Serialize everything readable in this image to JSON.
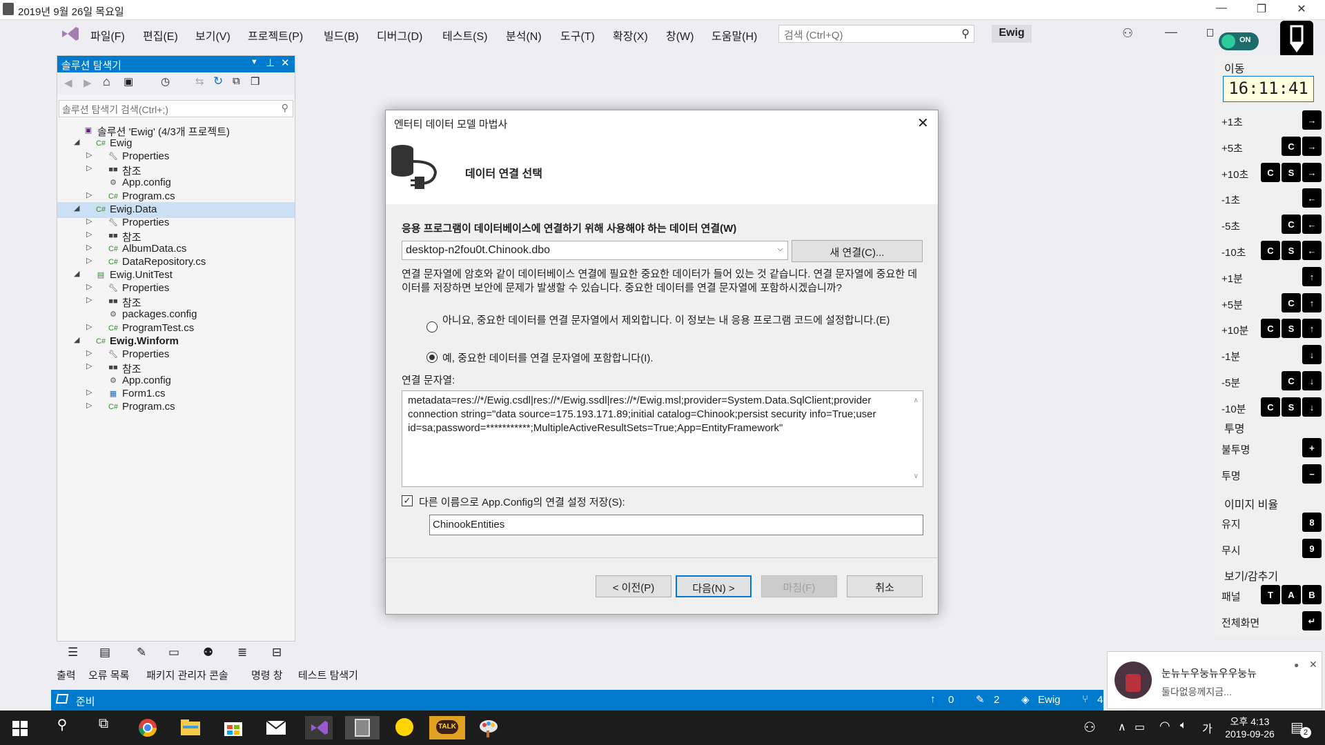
{
  "outer_title": {
    "text": "2019년 9월 26일 목요일"
  },
  "menu": {
    "items": [
      "파일(F)",
      "편집(E)",
      "보기(V)",
      "프로젝트(P)",
      "빌드(B)",
      "디버그(D)",
      "테스트(S)",
      "분석(N)",
      "도구(T)",
      "확장(X)",
      "창(W)",
      "도움말(H)"
    ],
    "search_placeholder": "검색 (Ctrl+Q)",
    "solution_name": "Ewig",
    "toggle_label": "ON"
  },
  "solution_explorer": {
    "title": "솔루션 탐색기",
    "search_placeholder": "솔루션 탐색기 검색(Ctrl+;)",
    "tree": [
      {
        "label": "솔루션 'Ewig' (4/3개 프로젝트)",
        "depth": 0,
        "arrow": "",
        "icon": "solution"
      },
      {
        "label": "Ewig",
        "depth": 1,
        "arrow": "◢",
        "icon": "csproj"
      },
      {
        "label": "Properties",
        "depth": 2,
        "arrow": "▷",
        "icon": "wrench"
      },
      {
        "label": "참조",
        "depth": 2,
        "arrow": "▷",
        "icon": "ref"
      },
      {
        "label": "App.config",
        "depth": 2,
        "arrow": "",
        "icon": "config"
      },
      {
        "label": "Program.cs",
        "depth": 2,
        "arrow": "▷",
        "icon": "cs"
      },
      {
        "label": "Ewig.Data",
        "depth": 1,
        "arrow": "◢",
        "icon": "csproj",
        "selected": true
      },
      {
        "label": "Properties",
        "depth": 2,
        "arrow": "▷",
        "icon": "wrench"
      },
      {
        "label": "참조",
        "depth": 2,
        "arrow": "▷",
        "icon": "ref"
      },
      {
        "label": "AlbumData.cs",
        "depth": 2,
        "arrow": "▷",
        "icon": "cs"
      },
      {
        "label": "DataRepository.cs",
        "depth": 2,
        "arrow": "▷",
        "icon": "cs"
      },
      {
        "label": "Ewig.UnitTest",
        "depth": 1,
        "arrow": "◢",
        "icon": "testproj"
      },
      {
        "label": "Properties",
        "depth": 2,
        "arrow": "▷",
        "icon": "wrench"
      },
      {
        "label": "참조",
        "depth": 2,
        "arrow": "▷",
        "icon": "ref"
      },
      {
        "label": "packages.config",
        "depth": 2,
        "arrow": "",
        "icon": "config"
      },
      {
        "label": "ProgramTest.cs",
        "depth": 2,
        "arrow": "▷",
        "icon": "cs"
      },
      {
        "label": "Ewig.Winform",
        "depth": 1,
        "arrow": "◢",
        "icon": "csproj",
        "bold": true
      },
      {
        "label": "Properties",
        "depth": 2,
        "arrow": "▷",
        "icon": "wrench"
      },
      {
        "label": "참조",
        "depth": 2,
        "arrow": "▷",
        "icon": "ref"
      },
      {
        "label": "App.config",
        "depth": 2,
        "arrow": "",
        "icon": "config"
      },
      {
        "label": "Form1.cs",
        "depth": 2,
        "arrow": "▷",
        "icon": "form"
      },
      {
        "label": "Program.cs",
        "depth": 2,
        "arrow": "▷",
        "icon": "cs"
      }
    ]
  },
  "bottom_tabs": [
    "출력",
    "오류 목록",
    "패키지 관리자 콘솔",
    "명령 창",
    "테스트 탐색기"
  ],
  "statusbar": {
    "left": "준비",
    "up": "0",
    "edit": "2",
    "repo": "Ewig",
    "branch": "4"
  },
  "dialog": {
    "title": "엔터티 데이터 모델 마법사",
    "subtitle": "데이터 연결 선택",
    "question": "응용 프로그램이 데이터베이스에 연결하기 위해 사용해야 하는 데이터 연결(W)",
    "connection": "desktop-n2fou0t.Chinook.dbo",
    "new_conn": "새 연결(C)...",
    "warning": "연결 문자열에 암호와 같이 데이터베이스 연결에 필요한 중요한 데이터가 들어 있는 것 같습니다. 연결 문자열에 중요한 데이터를 저장하면 보안에 문제가 발생할 수 있습니다. 중요한 데이터를 연결 문자열에 포함하시겠습니까?",
    "radio_no": "아니요, 중요한 데이터를 연결 문자열에서 제외합니다. 이 정보는 내 응용 프로그램 코드에 설정합니다.(E)",
    "radio_yes": "예, 중요한 데이터를 연결 문자열에 포함합니다(I).",
    "connstr_label": "연결 문자열:",
    "connstr": "metadata=res://*/Ewig.csdl|res://*/Ewig.ssdl|res://*/Ewig.msl;provider=System.Data.SqlClient;provider connection string=\"data source=175.193.171.89;initial catalog=Chinook;persist security info=True;user id=sa;password=***********;MultipleActiveResultSets=True;App=EntityFramework\"",
    "save_check": "다른 이름으로 App.Config의 연결 설정 저장(S):",
    "config_name": "ChinookEntities",
    "btn_prev": "< 이전(P)",
    "btn_next": "다음(N) >",
    "btn_finish": "마침(F)",
    "btn_cancel": "취소"
  },
  "right_panel": {
    "move_label": "이동",
    "clock": "16:11:41",
    "rows": [
      {
        "label": "+1초",
        "keys": [
          "→"
        ]
      },
      {
        "label": "+5초",
        "keys": [
          "C",
          "→"
        ]
      },
      {
        "label": "+10초",
        "keys": [
          "C",
          "S",
          "→"
        ]
      },
      {
        "label": "-1초",
        "keys": [
          "←"
        ]
      },
      {
        "label": "-5초",
        "keys": [
          "C",
          "←"
        ]
      },
      {
        "label": "-10초",
        "keys": [
          "C",
          "S",
          "←"
        ]
      },
      {
        "label": "+1분",
        "keys": [
          "↑"
        ]
      },
      {
        "label": "+5분",
        "keys": [
          "C",
          "↑"
        ]
      },
      {
        "label": "+10분",
        "keys": [
          "C",
          "S",
          "↑"
        ]
      },
      {
        "label": "-1분",
        "keys": [
          "↓"
        ]
      },
      {
        "label": "-5분",
        "keys": [
          "C",
          "↓"
        ]
      },
      {
        "label": "-10분",
        "keys": [
          "C",
          "S",
          "↓"
        ]
      }
    ],
    "transparency_label": "투명",
    "opaque": "불투명",
    "opaque_key": "+",
    "transparent": "투명",
    "transparent_key": "−",
    "ratio_label": "이미지 비율",
    "keep": "유지",
    "keep_key": "8",
    "ignore": "무시",
    "ignore_key": "9",
    "view_label": "보기/감추기",
    "panel": "패널",
    "panel_keys": [
      "T",
      "A",
      "B"
    ],
    "fullscreen": "전체화면",
    "fullscreen_key": "↵"
  },
  "toast": {
    "title": "눈뉴누우눙뉴우우눙뉴",
    "body": "둘다없응께지금..."
  },
  "taskbar": {
    "time": "오후 4:13",
    "date": "2019-09-26",
    "ime": "가",
    "notif_count": "2",
    "talk": "TALK"
  }
}
